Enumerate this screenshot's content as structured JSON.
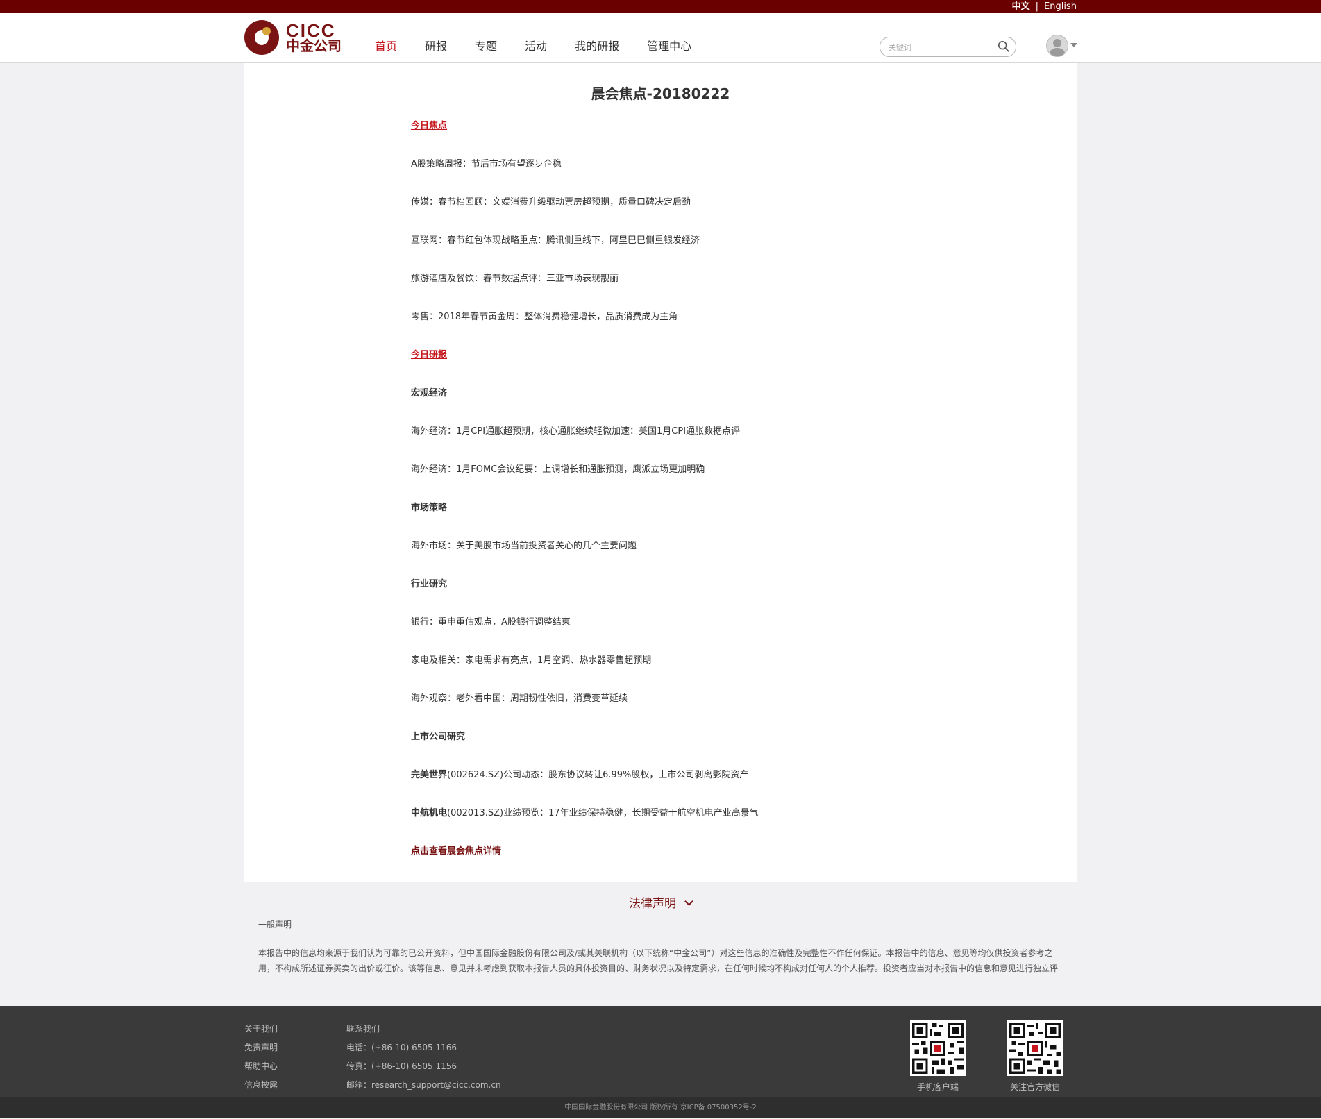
{
  "lang": {
    "zh": "中文",
    "sep": "|",
    "en": "English"
  },
  "logo": {
    "en": "CICC",
    "cn": "中金公司"
  },
  "nav": [
    {
      "label": "首页"
    },
    {
      "label": "研报"
    },
    {
      "label": "专题"
    },
    {
      "label": "活动"
    },
    {
      "label": "我的研报"
    },
    {
      "label": "管理中心"
    }
  ],
  "search": {
    "placeholder": "关键词"
  },
  "article": {
    "title": "晨会焦点-20180222",
    "lines": [
      "今日焦点",
      "A股策略周报：节后市场有望逐步企稳",
      "传媒：春节档回顾：文娱消费升级驱动票房超预期，质量口碑决定后劲",
      "互联网：春节红包体现战略重点：腾讯侧重线下，阿里巴巴侧重银发经济",
      "旅游酒店及餐饮：春节数据点评：三亚市场表现靓丽",
      "零售：2018年春节黄金周：整体消费稳健增长，品质消费成为主角",
      "今日研报",
      "宏观经济",
      "海外经济：1月CPI通胀超预期，核心通胀继续轻微加速：美国1月CPI通胀数据点评",
      "海外经济：1月FOMC会议纪要：上调增长和通胀预测，鹰派立场更加明确",
      "市场策略",
      "海外市场：关于美股市场当前投资者关心的几个主要问题",
      "行业研究",
      "银行：重申重估观点，A股银行调整结束",
      "家电及相关：家电需求有亮点，1月空调、热水器零售超预期",
      "海外观察：老外看中国：周期韧性依旧，消费变革延续",
      "上市公司研究",
      "(002624.SZ)公司动态：股东协议转让6.99%股权，上市公司剥离影院资产",
      "(002013.SZ)业绩预览：17年业绩保持稳健，长期受益于航空机电产业高景气",
      "点击查看晨会焦点详情"
    ],
    "company1": "完美世界",
    "company2": "中航机电"
  },
  "legal": {
    "title": "法律声明",
    "sub": "一般声明",
    "text": "本报告中的信息均来源于我们认为可靠的已公开资料，但中国国际金融股份有限公司及/或其关联机构（以下统称“中金公司”）对这些信息的准确性及完整性不作任何保证。本报告中的信息、意见等均仅供投资者参考之用，不构成所述证券买卖的出价或征价。该等信息、意见并未考虑到获取本报告人员的具体投资目的、财务状况以及特定需求，在任何时候均不构成对任何人的个人推荐。投资者应当对本报告中的信息和意见进行独立评"
  },
  "footer": {
    "col1": [
      "关于我们",
      "免责声明",
      "帮助中心",
      "信息披露"
    ],
    "col2": [
      "联系我们",
      "电话：(+86-10) 6505 1166",
      "传真：(+86-10) 6505 1156",
      "邮箱：research_support@cicc.com.cn"
    ],
    "qr1_label": "手机客户端",
    "qr2_label": "关注官方微信",
    "copyright": "中国国际金融股份有限公司 版权所有 京ICP备 07500352号-2"
  }
}
